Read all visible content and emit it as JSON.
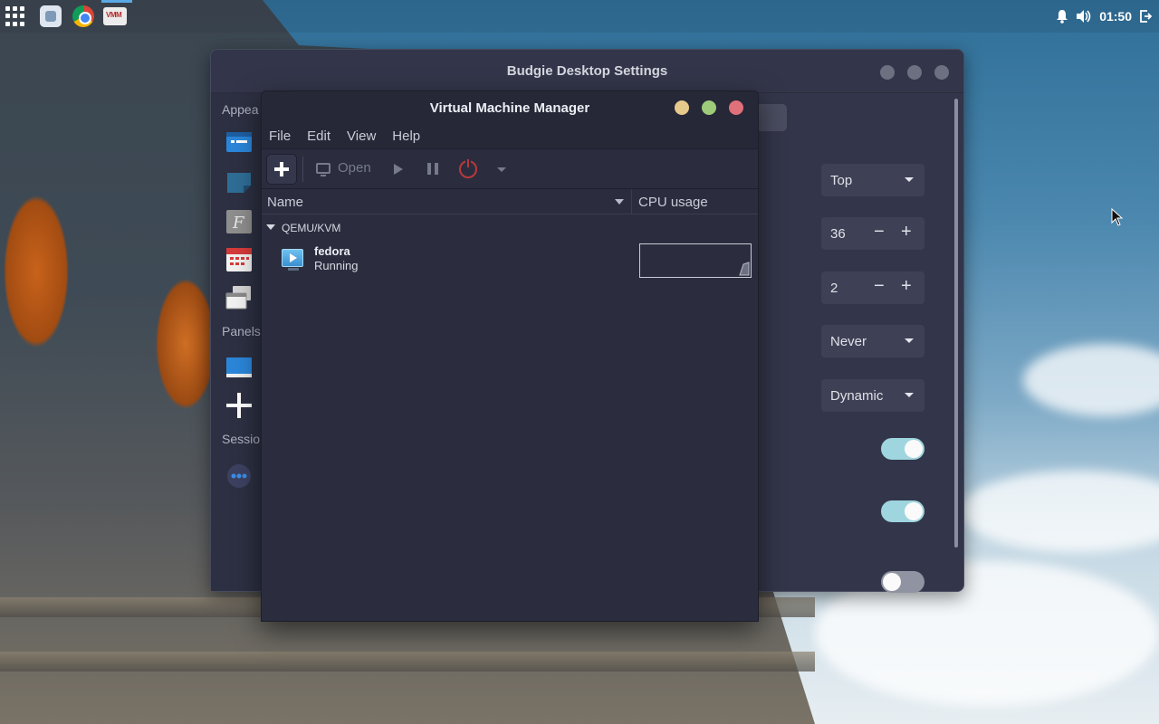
{
  "panel": {
    "clock": "01:50",
    "icons": [
      "app-launcher-icon",
      "files-app-icon",
      "chrome-icon",
      "virt-manager-icon",
      "bell-icon",
      "volume-icon",
      "logout-icon"
    ]
  },
  "budgie_settings": {
    "title": "Budgie Desktop Settings",
    "sidebar": {
      "appearance_heading": "Appea",
      "panels_heading": "Panels",
      "session_heading": "Sessio"
    },
    "settings": {
      "position": "Top",
      "size": "36",
      "spacing": "2",
      "autohide": "Never",
      "transparency": "Dynamic",
      "toggles": [
        true,
        true,
        false
      ]
    }
  },
  "vmm": {
    "title": "Virtual Machine Manager",
    "menu": [
      "File",
      "Edit",
      "View",
      "Help"
    ],
    "toolbar": {
      "open_label": "Open"
    },
    "columns": {
      "name": "Name",
      "cpu": "CPU usage"
    },
    "group": "QEMU/KVM",
    "vms": [
      {
        "name": "fedora",
        "state": "Running"
      }
    ],
    "colors": {
      "close": "#e0707a",
      "maximize": "#9ecb7a",
      "minimize": "#e8c98c",
      "accent": "#4ea3e2"
    }
  }
}
